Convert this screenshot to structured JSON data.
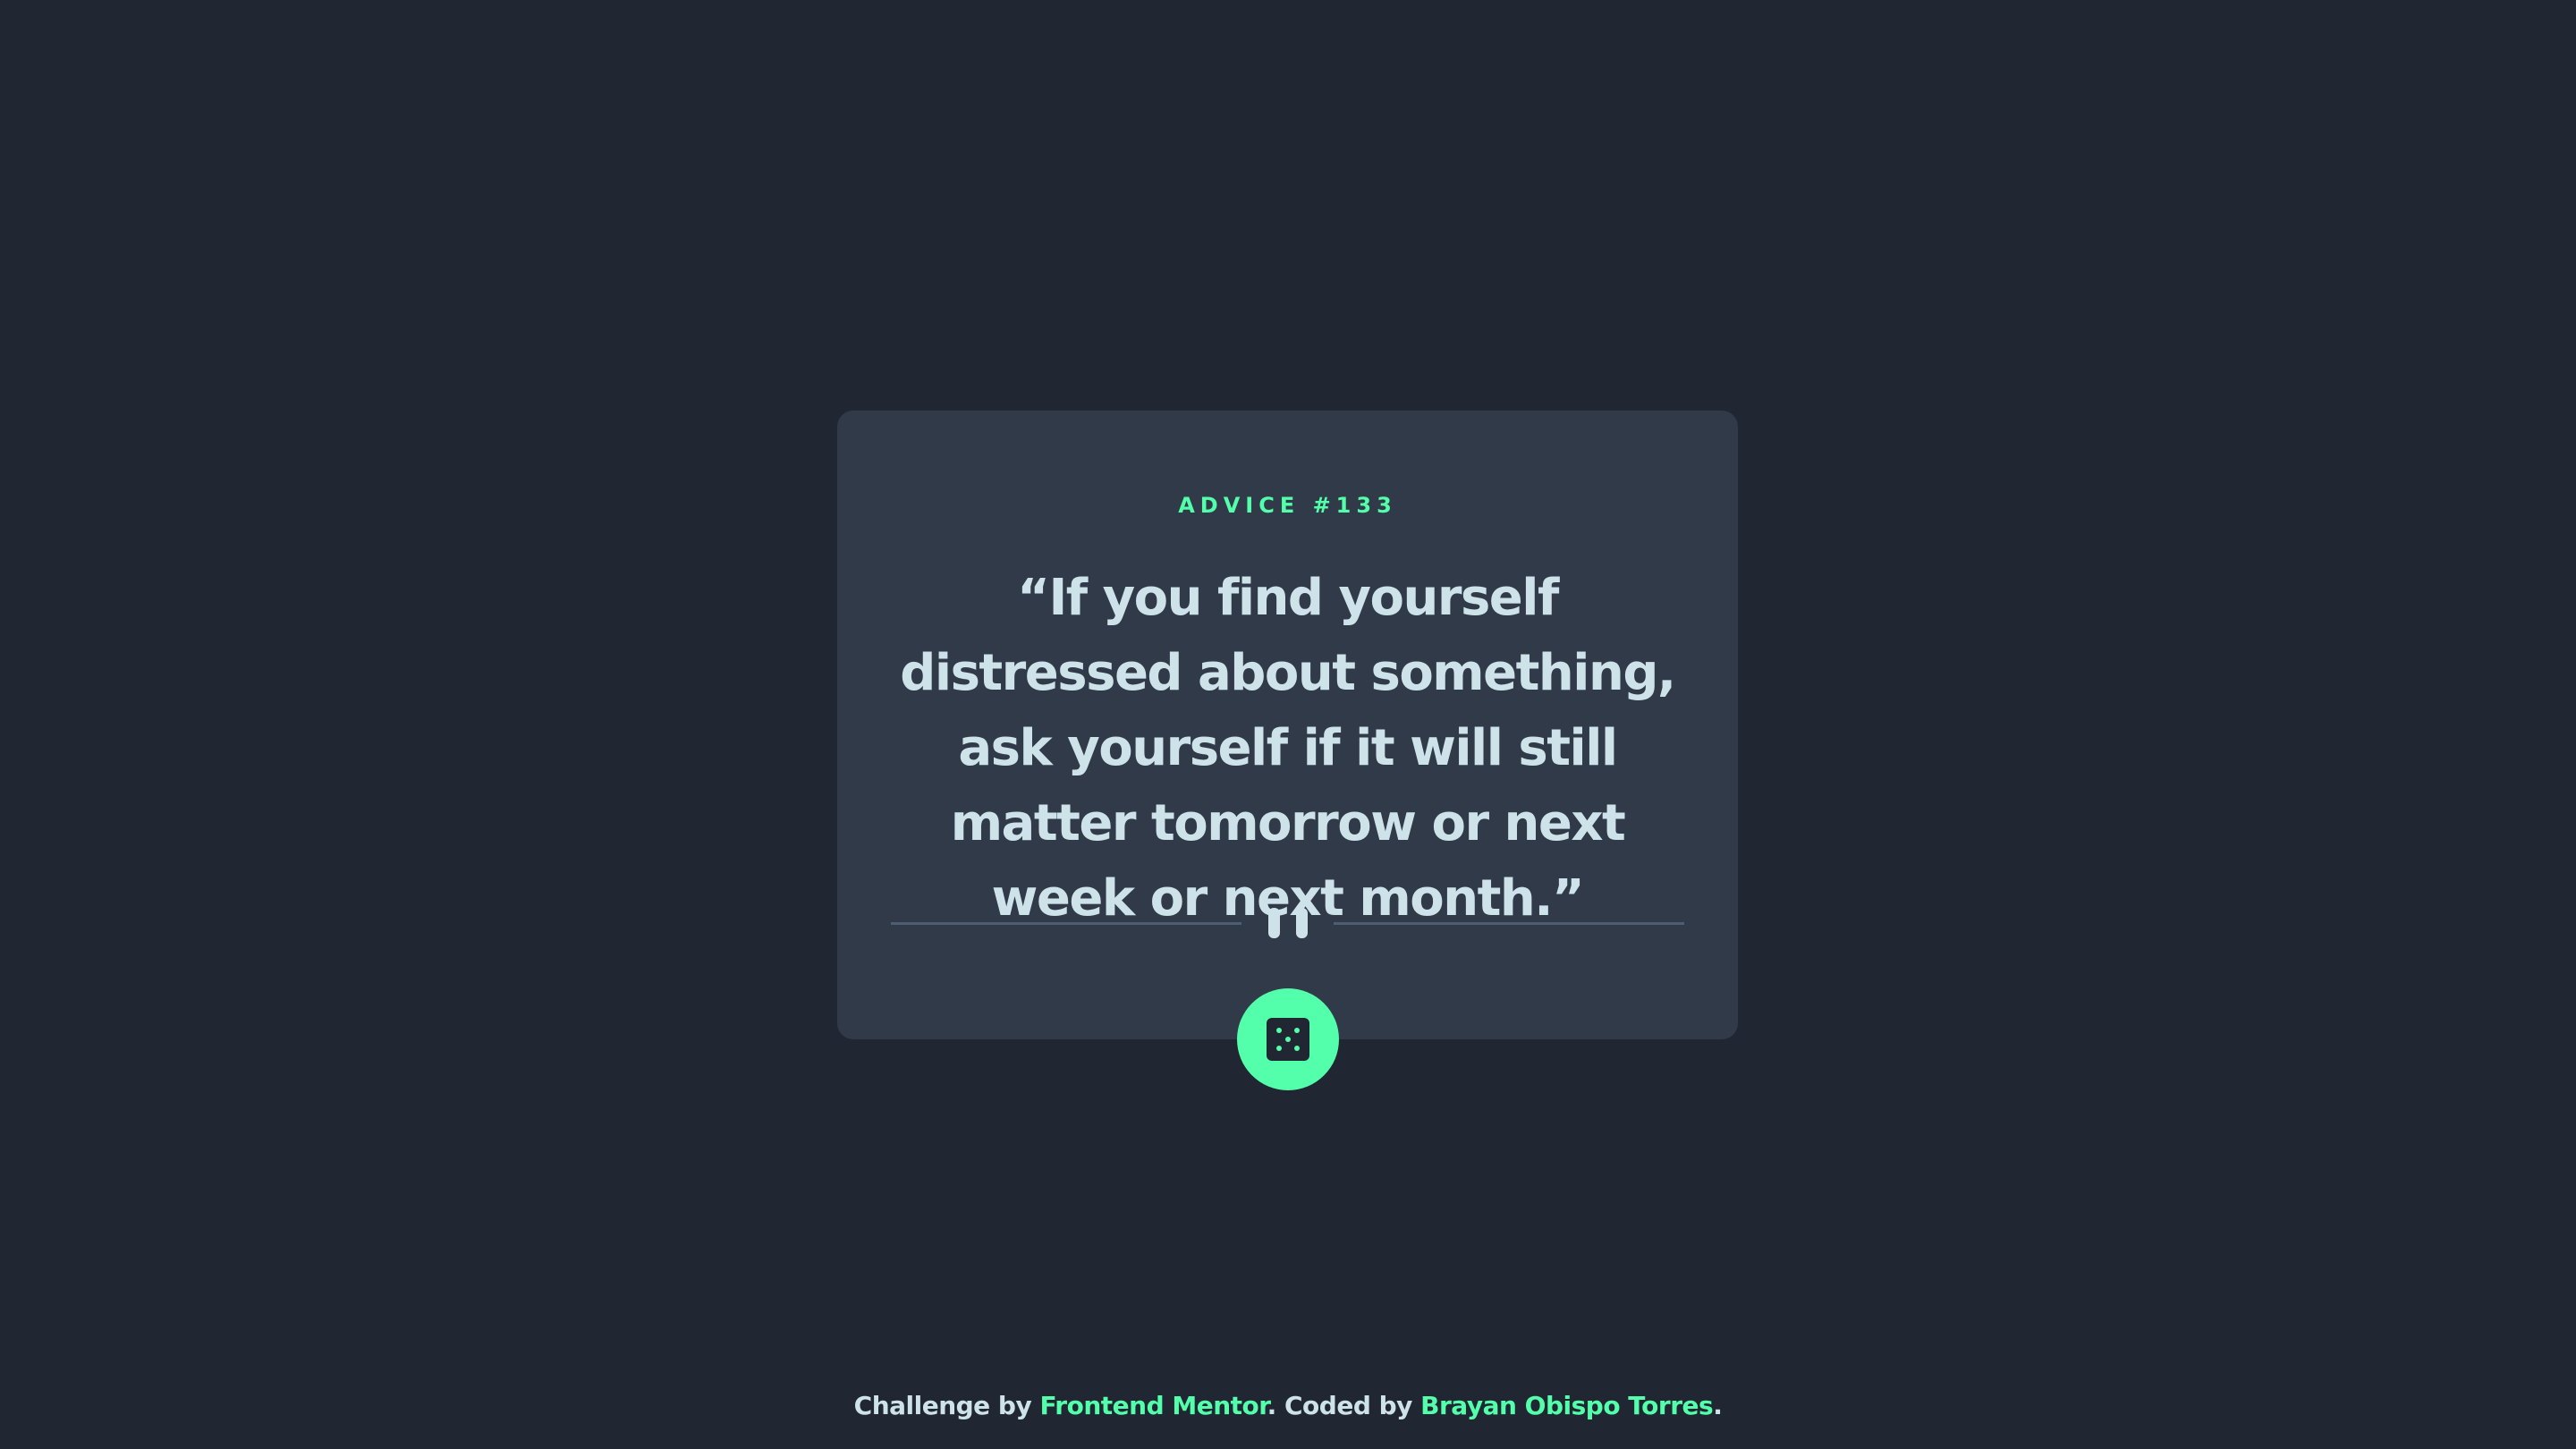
{
  "card": {
    "advice_id": "ADVICE #133",
    "quote": "“If you find yourself distressed about something, ask yourself if it will still matter tomorrow or next week or next month.”"
  },
  "divider": {
    "icon": "pause-icon"
  },
  "dice_button": {
    "icon": "dice-icon"
  },
  "footer": {
    "challenge_text": "Challenge by ",
    "challenge_link": "Frontend Mentor",
    "coded_text": ". Coded by ",
    "author_link": "Brayan Obispo Torres",
    "end_text": "."
  },
  "colors": {
    "background": "#202733",
    "card": "#313a49",
    "accent": "#53ffaa",
    "text": "#cee3e9",
    "divider": "#4f5d74"
  }
}
